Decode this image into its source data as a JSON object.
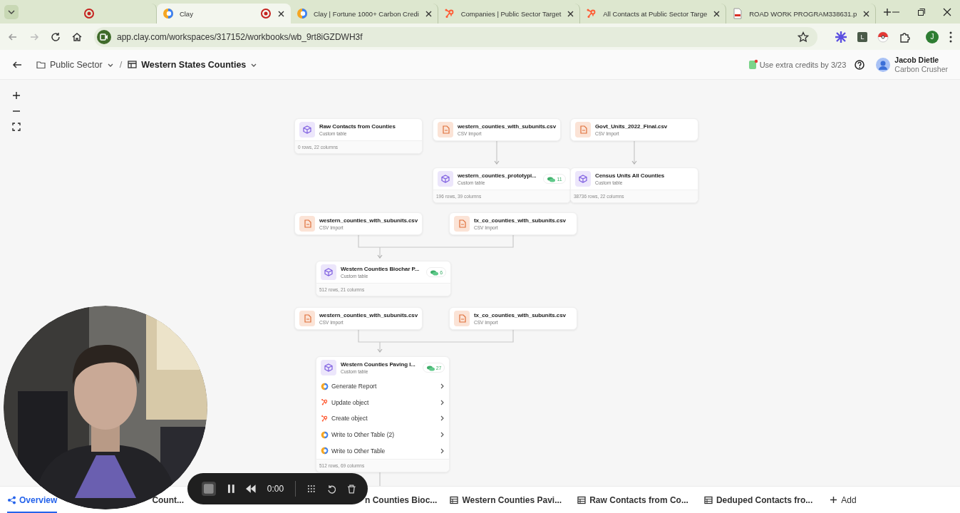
{
  "browser": {
    "tabs": [
      {
        "kind": "pinned",
        "selected": false,
        "recording": false
      },
      {
        "kind": "clay",
        "title": "Clay",
        "selected": true,
        "recording": true
      },
      {
        "kind": "clay",
        "title": "Clay | Fortune 1000+ Carbon Credi",
        "selected": false,
        "recording": false
      },
      {
        "kind": "hubspot",
        "title": "Companies | Public Sector Target",
        "selected": false,
        "recording": false
      },
      {
        "kind": "hubspot",
        "title": "All Contacts at Public Sector Targe",
        "selected": false,
        "recording": false
      },
      {
        "kind": "pdf",
        "title": "ROAD WORK PROGRAM338631.p",
        "selected": false,
        "recording": false
      }
    ],
    "url": "app.clay.com/workspaces/317152/workbooks/wb_9rt8iGZDWH3f",
    "extensions": [
      {
        "kind": "star"
      },
      {
        "kind": "letter",
        "label": "L"
      },
      {
        "kind": "ball"
      },
      {
        "kind": "puzzle"
      }
    ],
    "profile": "J"
  },
  "header": {
    "separator": "/",
    "breadcrumb": [
      {
        "kind": "folder",
        "label": "Public Sector"
      },
      {
        "kind": "workbook",
        "label": "Western States Counties"
      }
    ],
    "credits": "Use extra credits by 3/23",
    "user": {
      "name": "Jacob Dietle",
      "org": "Carbon Crusher"
    }
  },
  "canvas": {
    "nodes": [
      {
        "kind": "table",
        "title": "Raw Contacts from Counties",
        "subtitle": "Custom table",
        "footer": "0 rows, 22 columns"
      },
      {
        "kind": "csv",
        "title": "western_counties_with_subunits.csv",
        "subtitle": "CSV Import"
      },
      {
        "kind": "csv",
        "title": "Govt_Units_2022_Final.csv",
        "subtitle": "CSV Import"
      },
      {
        "kind": "table",
        "title": "western_counties_prototypi...",
        "subtitle": "Custom table",
        "badge": "11",
        "footer": "196 rows, 39 columns"
      },
      {
        "kind": "table",
        "title": "Census Units All Counties",
        "subtitle": "Custom table",
        "footer": "38736 rows, 22 columns"
      },
      {
        "kind": "csv",
        "title": "western_counties_with_subunits.csv",
        "subtitle": "CSV Import"
      },
      {
        "kind": "csv",
        "title": "tx_co_counties_with_subunits.csv",
        "subtitle": "CSV Import"
      },
      {
        "kind": "table",
        "title": "Western Counties Biochar P...",
        "subtitle": "Custom table",
        "badge": "6",
        "footer": "512 rows, 21 columns"
      },
      {
        "kind": "csv",
        "title": "western_counties_with_subunits.csv",
        "subtitle": "CSV Import"
      },
      {
        "kind": "csv",
        "title": "tx_co_counties_with_subunits.csv",
        "subtitle": "CSV Import"
      },
      {
        "kind": "table",
        "title": "Western Counties Paving I...",
        "subtitle": "Custom table",
        "badge": "27",
        "footer": "512 rows, 69 columns",
        "actions": [
          {
            "kind": "clay",
            "label": "Generate Report"
          },
          {
            "kind": "hubspot",
            "label": "Update object"
          },
          {
            "kind": "hubspot",
            "label": "Create object"
          },
          {
            "kind": "clay",
            "label": "Write to Other Table (2)"
          },
          {
            "kind": "clay",
            "label": "Write to Other Table"
          }
        ]
      }
    ]
  },
  "bottom_tabs": [
    {
      "kind": "overview",
      "label": "Overview",
      "selected": true
    },
    {
      "kind": "partial",
      "label": "Count...",
      "selected": false
    },
    {
      "kind": "partial",
      "label": "n Counties Bioc...",
      "selected": false
    },
    {
      "kind": "table",
      "label": "Western Counties Pavi...",
      "selected": false
    },
    {
      "kind": "table",
      "label": "Raw Contacts from Co...",
      "selected": false
    },
    {
      "kind": "table",
      "label": "Deduped Contacts fro...",
      "selected": false
    }
  ],
  "add_label": "Add",
  "recorder": {
    "time": "0:00"
  }
}
